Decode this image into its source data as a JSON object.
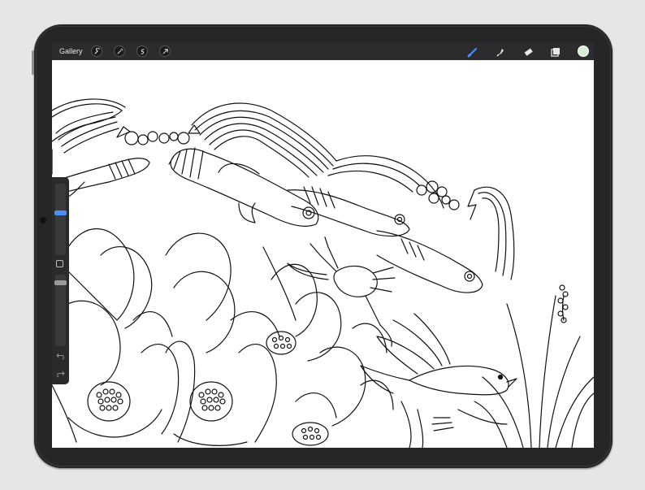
{
  "topbar": {
    "gallery_label": "Gallery",
    "left_tools": [
      "wrench-icon",
      "magic-wand-icon",
      "selection-icon",
      "transform-arrow-icon"
    ],
    "right_tools": [
      "brush-icon",
      "smudge-icon",
      "eraser-icon",
      "layers-icon"
    ],
    "active_tool": "brush-icon",
    "current_color": "#d7ecd5"
  },
  "sidebar": {
    "brush_size_level": 0.55,
    "opacity_level": 0.9,
    "accent_color": "#4a8ff7",
    "controls": [
      "modify-square-icon",
      "undo-icon",
      "redo-icon"
    ]
  },
  "canvas": {
    "subject": "line-art-drawing",
    "background": "#ffffff",
    "ink": "#111111"
  }
}
